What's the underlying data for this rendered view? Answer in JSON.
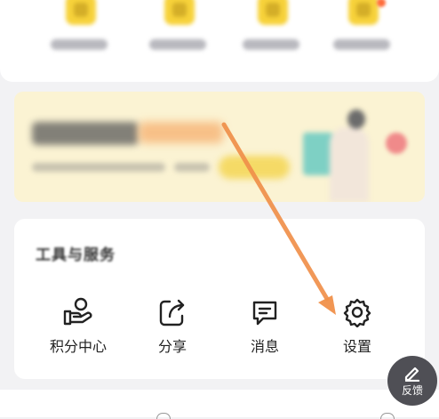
{
  "tools": {
    "title": "工具与服务",
    "items": [
      {
        "label": "积分中心",
        "icon": "points-center-icon"
      },
      {
        "label": "分享",
        "icon": "share-icon"
      },
      {
        "label": "消息",
        "icon": "message-icon"
      },
      {
        "label": "设置",
        "icon": "settings-gear-icon"
      }
    ]
  },
  "feedback": {
    "label": "反馈",
    "icon": "pencil-icon"
  },
  "colors": {
    "accent_yellow": "#f7d23a",
    "annotation_arrow": "#f0904a",
    "feedback_bg": "#4f4f55",
    "page_bg": "#f2f2f4"
  }
}
